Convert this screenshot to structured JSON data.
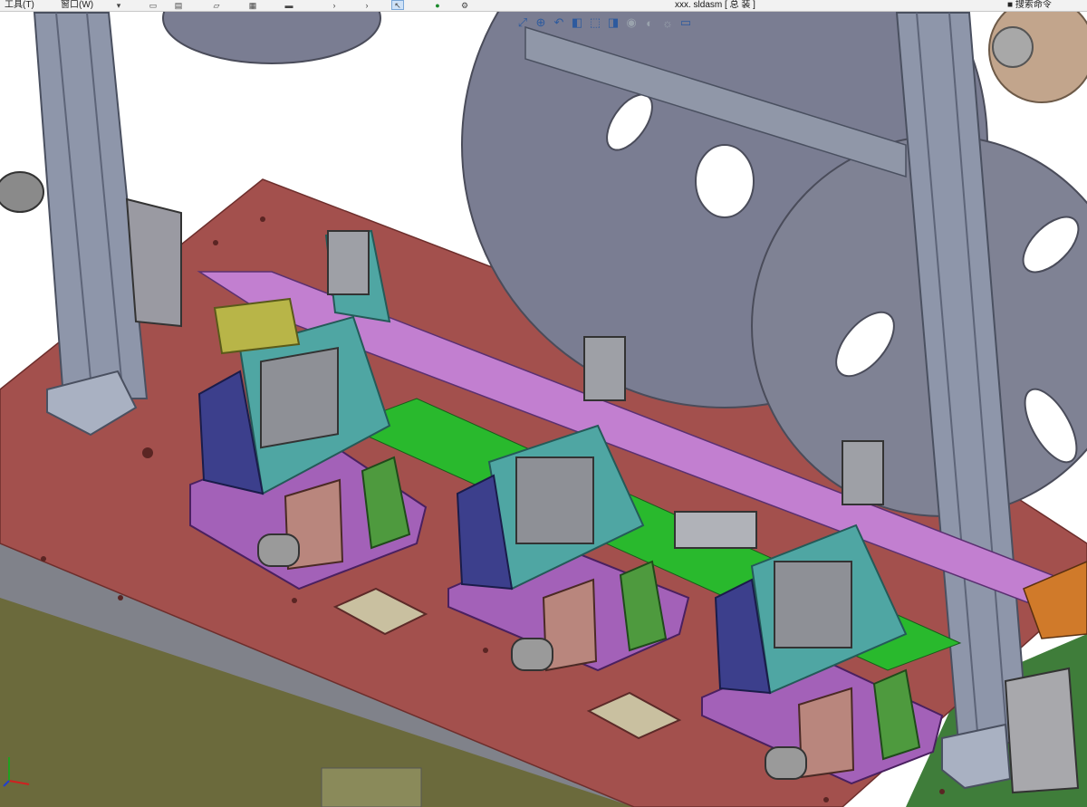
{
  "menu": {
    "items": [
      "工具(T)",
      "窗口(W)"
    ]
  },
  "toolbar": {
    "buttons": [
      "new-icon",
      "open-icon",
      "save-icon",
      "print-icon",
      "undo-icon",
      "redo-icon",
      "select-icon",
      "rebuild-icon",
      "options-icon"
    ],
    "select_glyph": "↖",
    "rebuild_glyph": "●",
    "options_glyph": "⚙"
  },
  "document": {
    "title": "xxx. sldasm [ 总 装 ]"
  },
  "right_panel": {
    "label": "搜索命令"
  },
  "heads_up_view": {
    "buttons": [
      "zoom-fit-icon",
      "zoom-area-icon",
      "previous-view-icon",
      "section-view-icon",
      "view-orientation-icon",
      "display-style-icon",
      "hide-show-icon",
      "appearance-icon",
      "scene-icon",
      "view-settings-icon"
    ],
    "glyphs": [
      "⤢",
      "⊕",
      "↶",
      "◧",
      "⬚",
      "◨",
      "◉",
      "◐",
      "☼",
      "▭"
    ]
  },
  "viewport": {
    "background": "#ffffff",
    "triad_axes": [
      "X",
      "Y",
      "Z"
    ]
  },
  "colors": {
    "base_plate": "#a3504d",
    "frame_body": "#6b6a3c",
    "frame_grey": "#7d7f88",
    "reel": "#7a7d92",
    "column": "#8e96aa",
    "teal": "#4fa6a3",
    "purple": "#a361b8",
    "green": "#29b92d",
    "navy": "#3c3f8c",
    "cylinder": "#8e9096",
    "salmon": "#b9867d",
    "olive": "#b8b548"
  }
}
